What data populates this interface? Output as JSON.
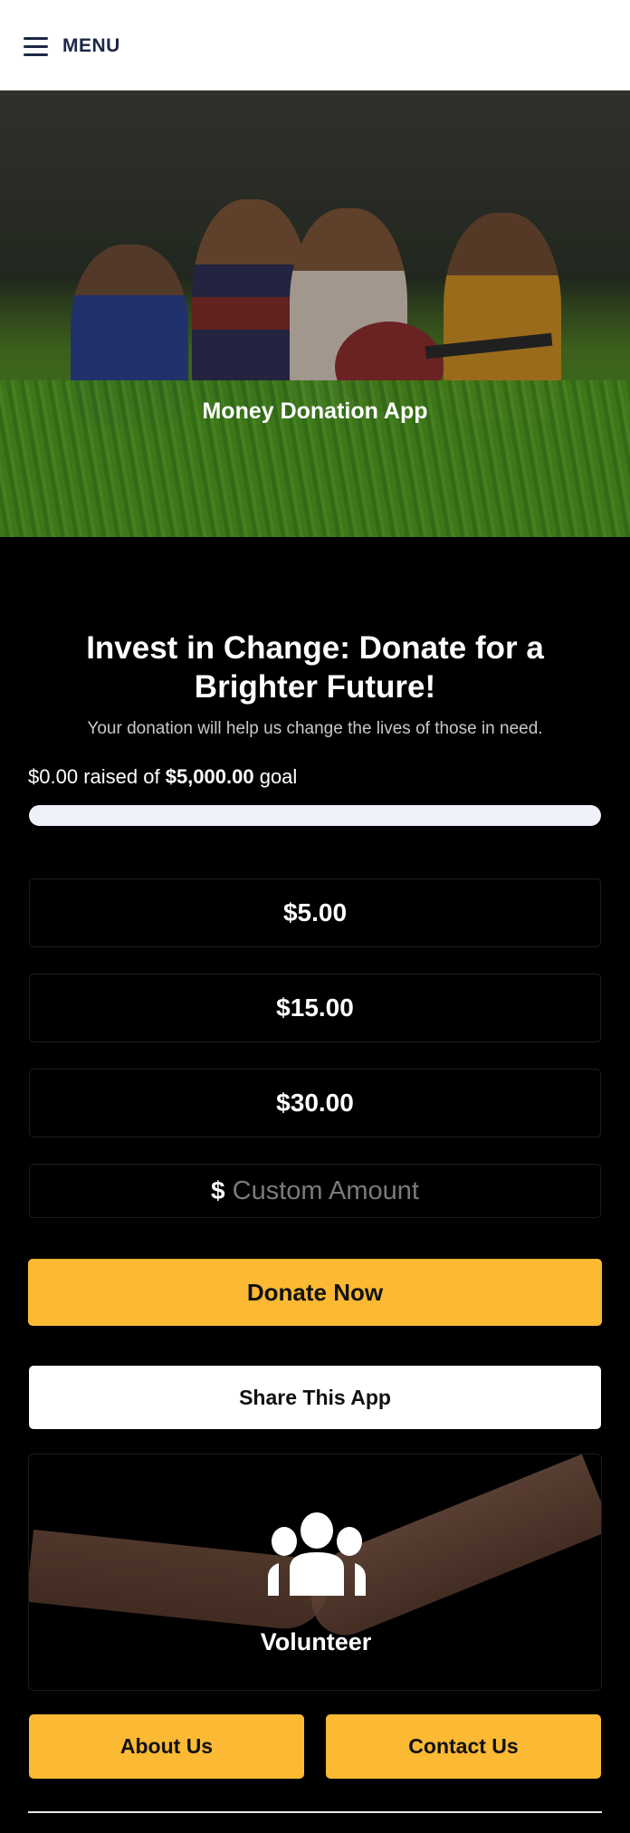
{
  "header": {
    "menu_label": "MENU",
    "menu_icon": "hamburger-icon"
  },
  "hero": {
    "title": "Money Donation App",
    "image": "children-in-grass-photo"
  },
  "campaign": {
    "headline": "Invest in Change: Donate for a Brighter Future!",
    "subline": "Your donation will help us change the lives of those in need.",
    "raised_amount": "$0.00",
    "raised_text": "raised of",
    "goal_amount": "$5,000.00",
    "goal_text": "goal",
    "progress_fraction": 0.0
  },
  "amounts": [
    {
      "label": "$5.00"
    },
    {
      "label": "$15.00"
    },
    {
      "label": "$30.00"
    }
  ],
  "custom_amount": {
    "currency_symbol": "$",
    "placeholder": "Custom Amount",
    "value": ""
  },
  "actions": {
    "donate_label": "Donate Now",
    "share_label": "Share This App"
  },
  "volunteer": {
    "label": "Volunteer",
    "icon": "users-group-icon",
    "image": "reaching-hands-photo"
  },
  "footer_buttons": {
    "about_label": "About Us",
    "contact_label": "Contact Us"
  },
  "colors": {
    "accent": "#fbb934",
    "menu_text": "#1d2746",
    "background": "#000000",
    "progress_track": "#eef0fa"
  }
}
